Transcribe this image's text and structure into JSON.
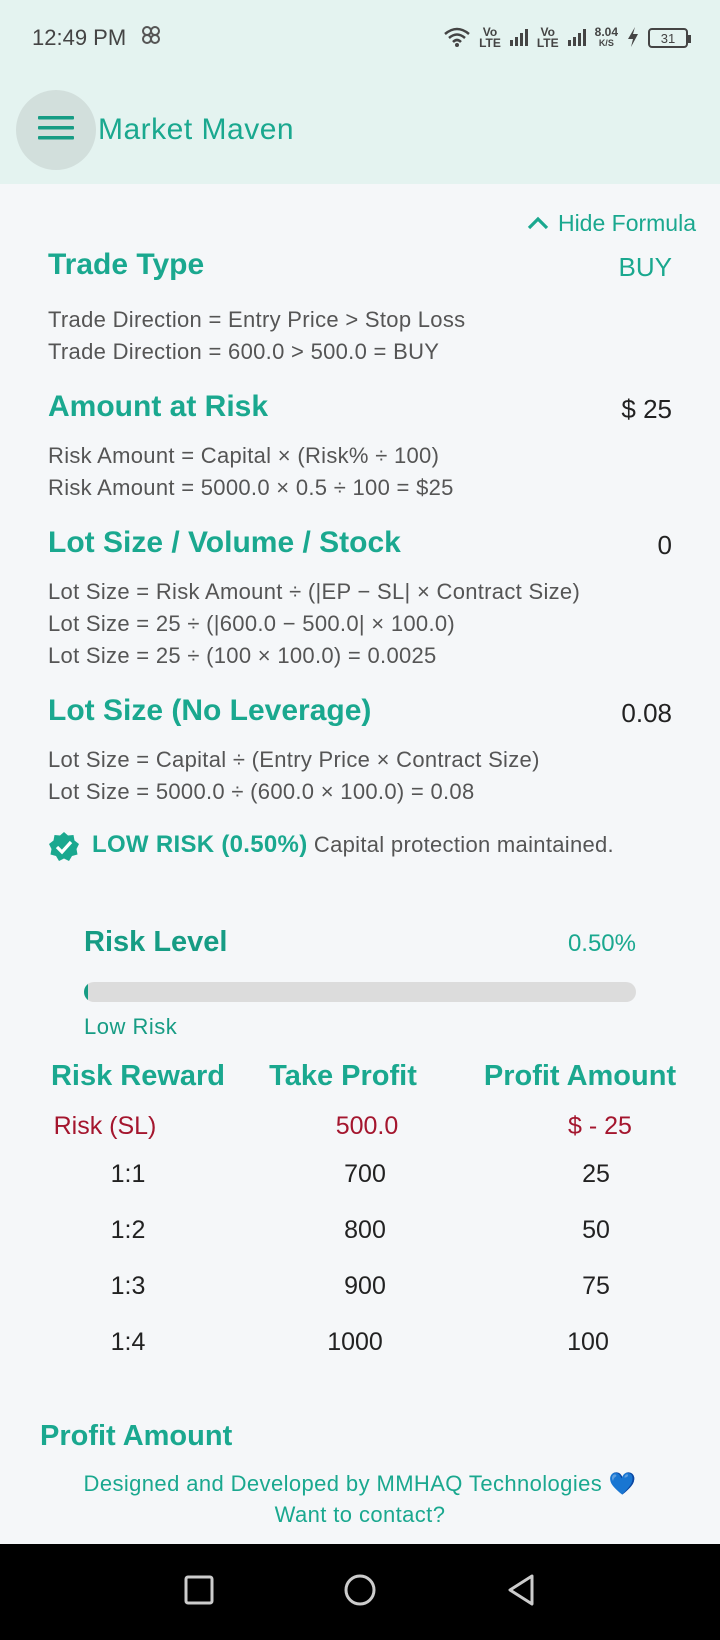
{
  "status": {
    "time": "12:49 PM",
    "net1": "Vo\nLTE",
    "net2": "Vo\nLTE",
    "speed": "8.04",
    "speed_unit": "K/S",
    "battery": "31"
  },
  "app": {
    "title": "Market Maven"
  },
  "toggle": {
    "label": "Hide Formula"
  },
  "sections": [
    {
      "title": "Trade Type",
      "value": "BUY",
      "formulas": [
        "Trade Direction = Entry Price > Stop Loss",
        "Trade Direction = 600.0 > 500.0 = BUY"
      ]
    },
    {
      "title": "Amount at Risk",
      "value": "$ 25",
      "formulas": [
        "Risk Amount = Capital × (Risk% ÷ 100)",
        "Risk Amount = 5000.0 × 0.5 ÷ 100 = $25"
      ]
    },
    {
      "title": "Lot Size / Volume / Stock",
      "value": "0",
      "formulas": [
        "Lot Size = Risk Amount ÷ (|EP − SL| × Contract Size)",
        "Lot Size = 25 ÷ (|600.0 − 500.0| × 100.0)",
        "Lot Size = 25 ÷ (100 × 100.0) = 0.0025"
      ]
    },
    {
      "title": "Lot Size (No Leverage)",
      "value": "0.08",
      "formulas": [
        "Lot Size = Capital ÷ (Entry Price × Contract Size)",
        "Lot Size = 5000.0 ÷ (600.0 × 100.0) = 0.08"
      ]
    }
  ],
  "risk_note": {
    "strong": "LOW RISK (0.50%)",
    "text": " Capital protection maintained."
  },
  "risk_level": {
    "title": "Risk Level",
    "percent_label": "0.50%",
    "fill_percent": 0.5,
    "label": "Low Risk"
  },
  "table": {
    "headers": [
      "Risk Reward",
      "Take Profit",
      "Profit Amount"
    ],
    "risk_row": [
      "Risk (SL)",
      "500.0",
      "$ - 25"
    ],
    "rows": [
      [
        "1:1",
        "700",
        "25"
      ],
      [
        "1:2",
        "800",
        "50"
      ],
      [
        "1:3",
        "900",
        "75"
      ],
      [
        "1:4",
        "1000",
        "100"
      ]
    ]
  },
  "profit_amount": {
    "title": "Profit Amount"
  },
  "footer": {
    "line1": "Designed and Developed by MMHAQ Technologies 💙",
    "line2": "Want to contact?"
  },
  "colors": {
    "accent": "#1aa88f",
    "risk_red": "#a4162e",
    "header_bg": "#e4f3f0"
  }
}
